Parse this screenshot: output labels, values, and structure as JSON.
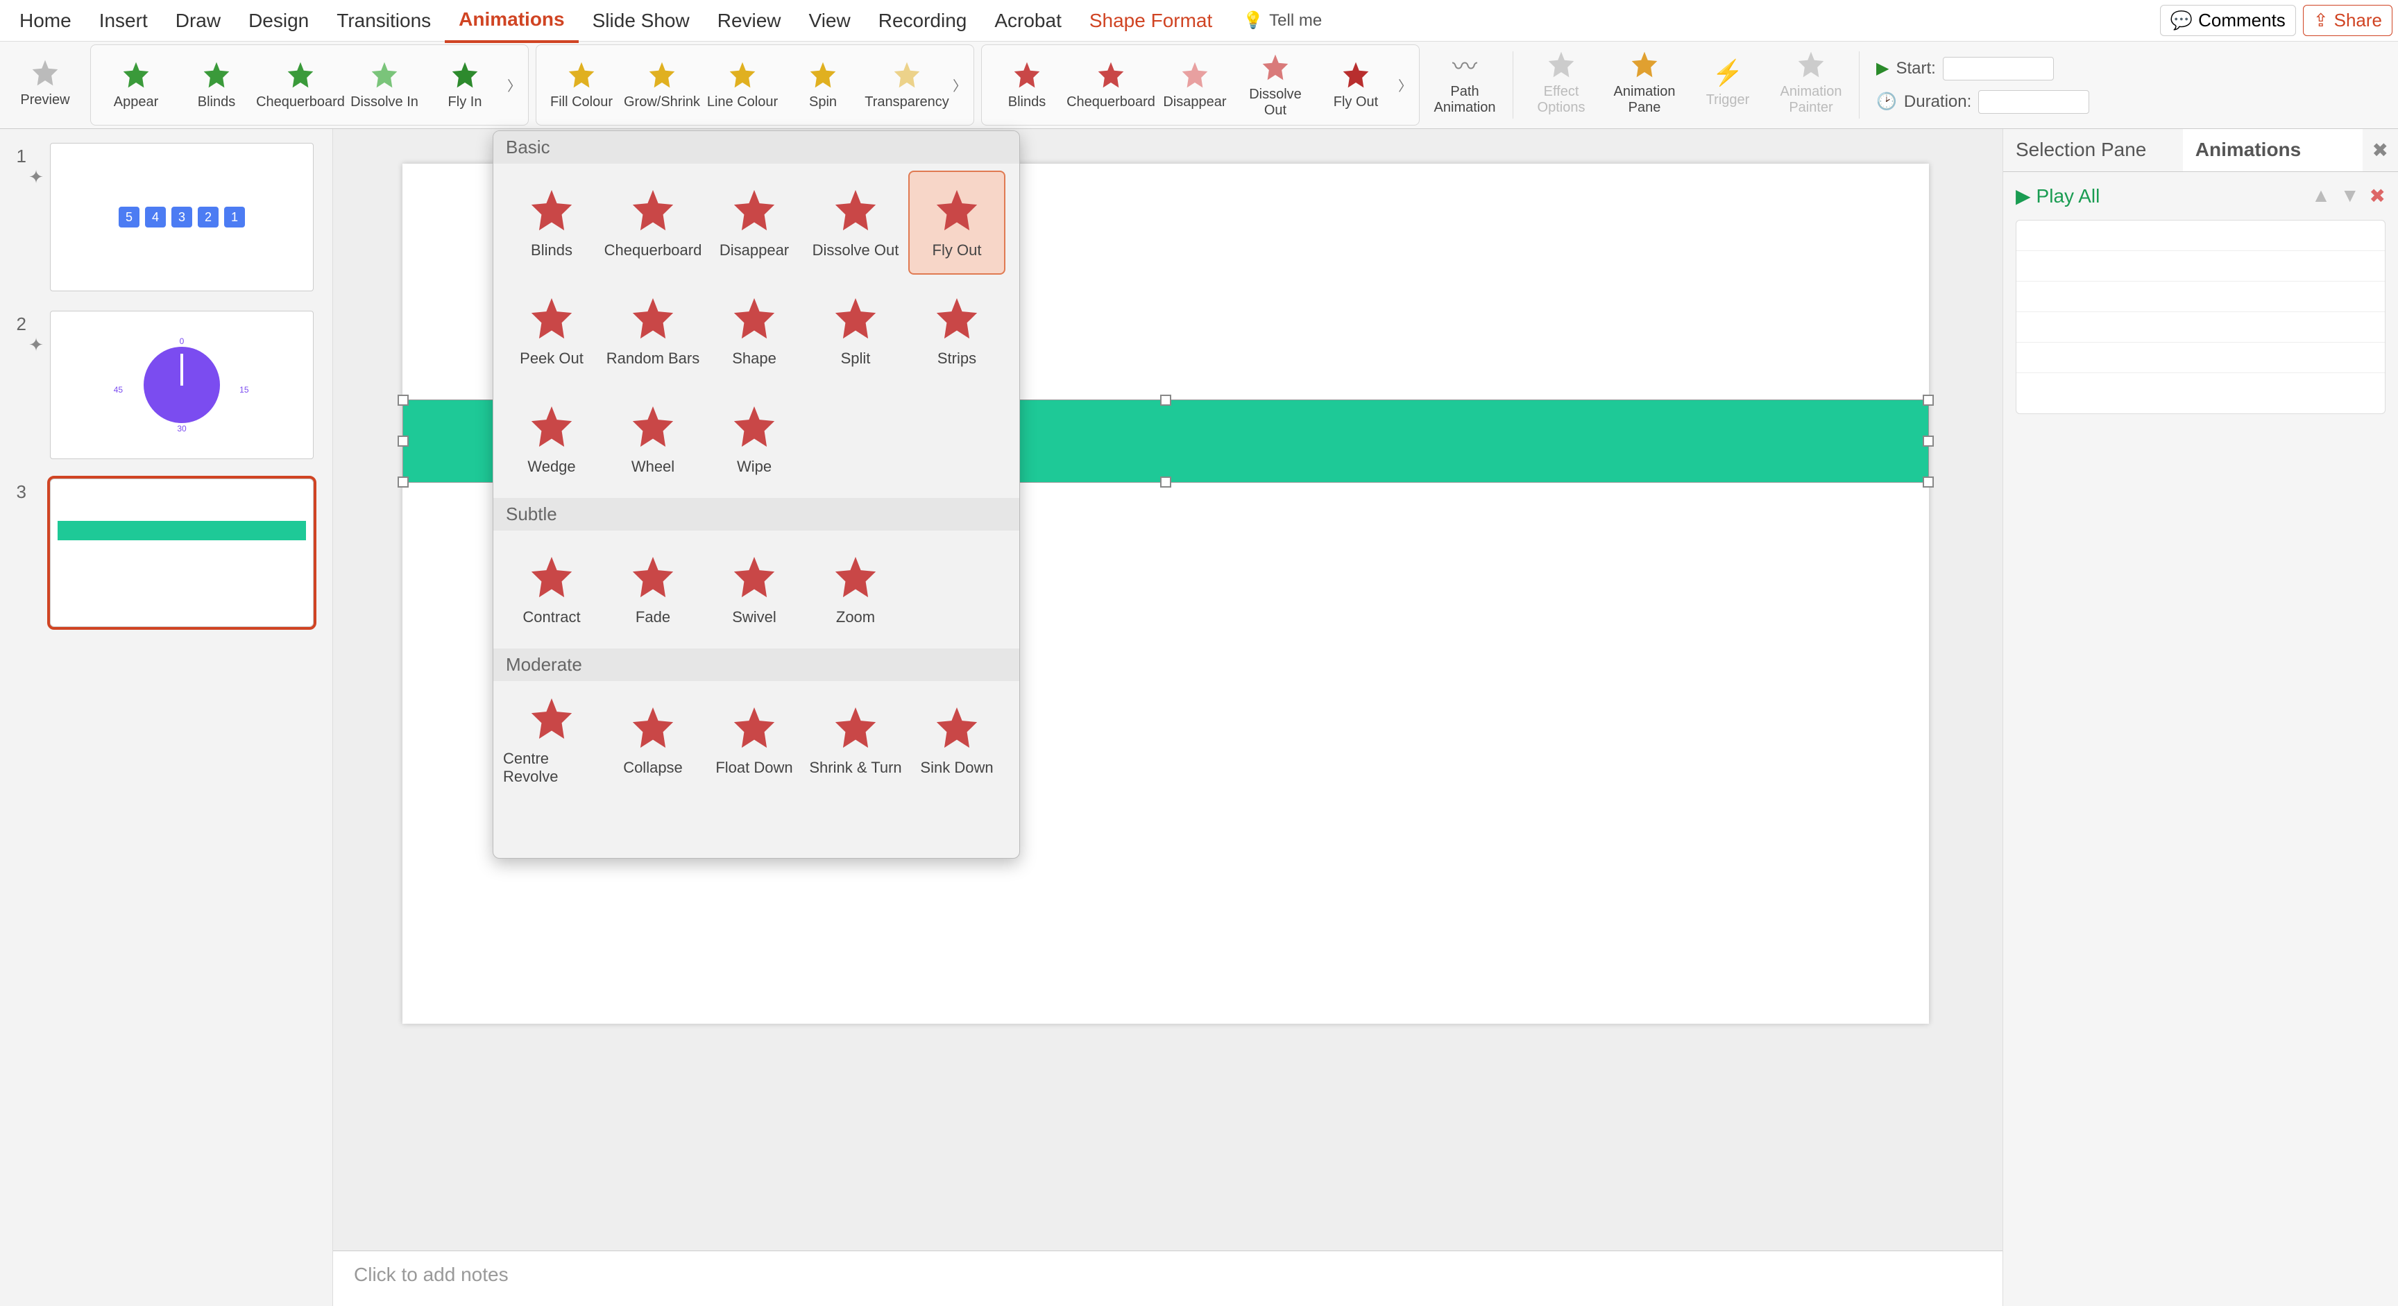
{
  "menubar": {
    "tabs": [
      "Home",
      "Insert",
      "Draw",
      "Design",
      "Transitions",
      "Animations",
      "Slide Show",
      "Review",
      "View",
      "Recording",
      "Acrobat",
      "Shape Format"
    ],
    "active": "Animations",
    "tellme": "Tell me",
    "comments": "Comments",
    "share": "Share"
  },
  "ribbon": {
    "preview": "Preview",
    "entrance": [
      "Appear",
      "Blinds",
      "Chequerboard",
      "Dissolve In",
      "Fly In"
    ],
    "emphasis": [
      "Fill Colour",
      "Grow/Shrink",
      "Line Colour",
      "Spin",
      "Transparency"
    ],
    "exit": [
      "Blinds",
      "Chequerboard",
      "Disappear",
      "Dissolve Out",
      "Fly Out"
    ],
    "path": "Path Animation",
    "effect_options": "Effect Options",
    "animation_pane": "Animation Pane",
    "trigger": "Trigger",
    "painter": "Animation Painter",
    "start_label": "Start:",
    "start_value": "",
    "duration_label": "Duration:",
    "duration_value": ""
  },
  "thumbs": {
    "slides": [
      {
        "num": "1",
        "boxes": [
          "5",
          "4",
          "3",
          "2",
          "1"
        ]
      },
      {
        "num": "2",
        "clock_labels": {
          "top": "0",
          "right": "15",
          "bottom": "30",
          "left": "45"
        }
      },
      {
        "num": "3"
      }
    ]
  },
  "dropdown": {
    "sections": [
      {
        "title": "Basic",
        "items": [
          "Blinds",
          "Chequerboard",
          "Disappear",
          "Dissolve Out",
          "Fly Out",
          "Peek Out",
          "Random Bars",
          "Shape",
          "Split",
          "Strips",
          "Wedge",
          "Wheel",
          "Wipe"
        ],
        "selected": "Fly Out"
      },
      {
        "title": "Subtle",
        "items": [
          "Contract",
          "Fade",
          "Swivel",
          "Zoom"
        ]
      },
      {
        "title": "Moderate",
        "items": [
          "Centre Revolve",
          "Collapse",
          "Float Down",
          "Shrink & Turn",
          "Sink Down"
        ]
      }
    ]
  },
  "right_pane": {
    "tabs": [
      "Selection Pane",
      "Animations"
    ],
    "active": "Animations",
    "play_all": "Play All"
  },
  "notes_placeholder": "Click to add notes"
}
